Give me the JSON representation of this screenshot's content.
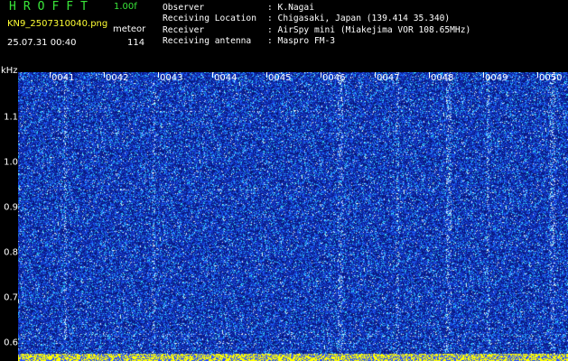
{
  "header": {
    "logo": "HROFFT",
    "version": "1.00f",
    "filename": "KN9_2507310040.png",
    "mode": "meteor",
    "datetime": "25.07.31 00:40",
    "count": "114"
  },
  "station": [
    {
      "label": "Observer",
      "value": ": K.Nagai"
    },
    {
      "label": "Receiving Location",
      "value": ": Chigasaki, Japan (139.414 35.340)"
    },
    {
      "label": "Receiver",
      "value": ": AirSpy mini (Miakejima VOR 108.65MHz)"
    },
    {
      "label": "Receiving antenna",
      "value": ": Maspro FM-3"
    }
  ],
  "y_axis": {
    "unit": "kHz",
    "ticks": [
      "1.1",
      "1.0",
      "0.9",
      "0.8",
      "0.7",
      "0.6"
    ]
  },
  "x_axis": {
    "ticks": [
      "0041",
      "0042",
      "0043",
      "0044",
      "0045",
      "0046",
      "0047",
      "0048",
      "0049",
      "0050"
    ]
  },
  "colors": {
    "background": "#000000",
    "noise_base": "#0a1a8c",
    "noise_mid": "#1e5cff",
    "noise_high": "#35d6ff",
    "noise_peak": "#ffffff",
    "band_bottom": "#ffff00",
    "logo": "#39e639",
    "filename": "#ffff33"
  }
}
